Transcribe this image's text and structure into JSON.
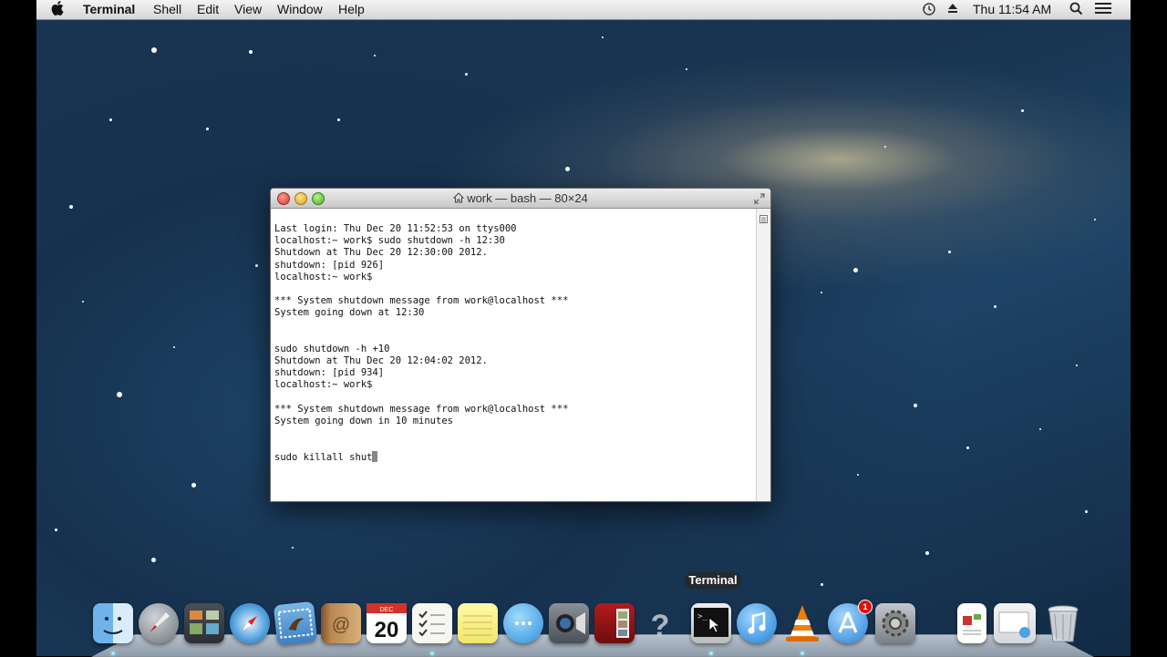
{
  "menubar": {
    "app_name": "Terminal",
    "menus": [
      "Shell",
      "Edit",
      "View",
      "Window",
      "Help"
    ],
    "clock": "Thu 11:54 AM"
  },
  "window": {
    "title": "work — bash — 80×24"
  },
  "terminal": {
    "lines": [
      "Last login: Thu Dec 20 11:52:53 on ttys000",
      "localhost:~ work$ sudo shutdown -h 12:30",
      "Shutdown at Thu Dec 20 12:30:00 2012.",
      "shutdown: [pid 926]",
      "localhost:~ work$",
      "",
      "*** System shutdown message from work@localhost ***",
      "System going down at 12:30",
      "",
      "",
      "sudo shutdown -h +10",
      "Shutdown at Thu Dec 20 12:04:02 2012.",
      "shutdown: [pid 934]",
      "localhost:~ work$",
      "",
      "*** System shutdown message from work@localhost ***",
      "System going down in 10 minutes",
      "",
      "",
      "sudo killall shut"
    ]
  },
  "dock": {
    "tooltip": "Terminal",
    "calendar_day": "20",
    "calendar_month": "DEC",
    "app_store_badge": "1",
    "items": [
      "finder-icon",
      "launchpad-icon",
      "mission-control-icon",
      "safari-icon",
      "mail-icon",
      "contacts-icon",
      "calendar-icon",
      "reminders-icon",
      "notes-icon",
      "messages-icon",
      "facetime-icon",
      "photo-booth-icon",
      "unknown-app-icon",
      "terminal-icon",
      "itunes-icon",
      "vlc-icon",
      "app-store-icon",
      "system-preferences-icon",
      "document-icon",
      "stack-icon",
      "trash-icon"
    ]
  }
}
